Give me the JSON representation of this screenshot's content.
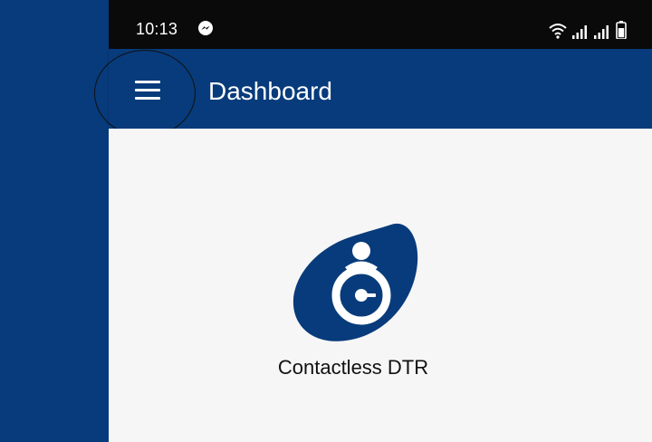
{
  "status_bar": {
    "time": "10:13",
    "icons": [
      "messenger-icon",
      "wifi-icon",
      "signal-icon",
      "signal-icon",
      "battery-icon"
    ]
  },
  "app_bar": {
    "menu_icon": "hamburger-menu-icon",
    "title": "Dashboard"
  },
  "tiles": [
    {
      "label": "Contactless DTR",
      "icon": "stopwatch-person-icon"
    }
  ],
  "colors": {
    "brand_blue": "#073b7b",
    "status_bar_bg": "#0a0a0a",
    "content_bg": "#f6f6f6",
    "label_text": "#111111"
  }
}
